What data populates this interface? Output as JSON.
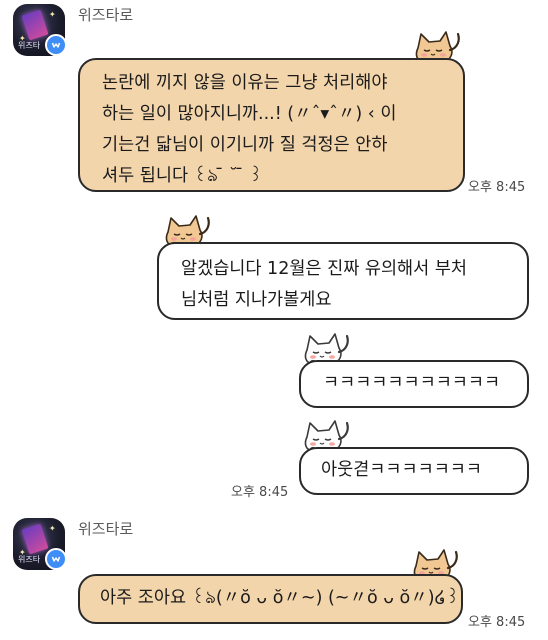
{
  "sender": {
    "name": "위즈타로",
    "avatar_text": "위즈타",
    "icon": "verified-badge-icon"
  },
  "messages": [
    {
      "direction": "incoming",
      "lines": [
        "논란에 끼지 않을 이유는 그냥 처리해야",
        "하는 일이 많아지니까...! (〃ˆ▾ˆ〃) ‹ 이",
        "기는건 닯님이 이기니까 질 걱정은 안하",
        "셔두 됩니다 ꒰ঌ ̄ ˘ ̄ ꒱"
      ],
      "time": "오후 8:45"
    },
    {
      "direction": "outgoing",
      "lines": [
        "알겠습니다 12월은 진짜 유의해서 부처",
        "님처럼 지나가볼게요"
      ]
    },
    {
      "direction": "outgoing",
      "lines": [
        "ㅋㅋㅋㅋㅋㅋㅋㅋㅋㅋㅋ"
      ]
    },
    {
      "direction": "outgoing",
      "lines": [
        "아웃겯ㅋㅋㅋㅋㅋㅋㅋ"
      ],
      "time": "오후 8:45"
    },
    {
      "direction": "incoming",
      "lines": [
        "아주 조아요 ꒰ঌ(〃ŏ ᴗ ŏ〃~) (~〃ŏ ᴗ ŏ〃)໒꒱"
      ],
      "time": "오후 8:45"
    }
  ],
  "colors": {
    "incoming_bubble": "#f3d5ab",
    "outgoing_bubble": "#ffffff",
    "bubble_border": "#2a2a2a",
    "badge": "#3f8df6"
  },
  "decorations": {
    "bubble_icon": "sleeping-cat-icon"
  }
}
